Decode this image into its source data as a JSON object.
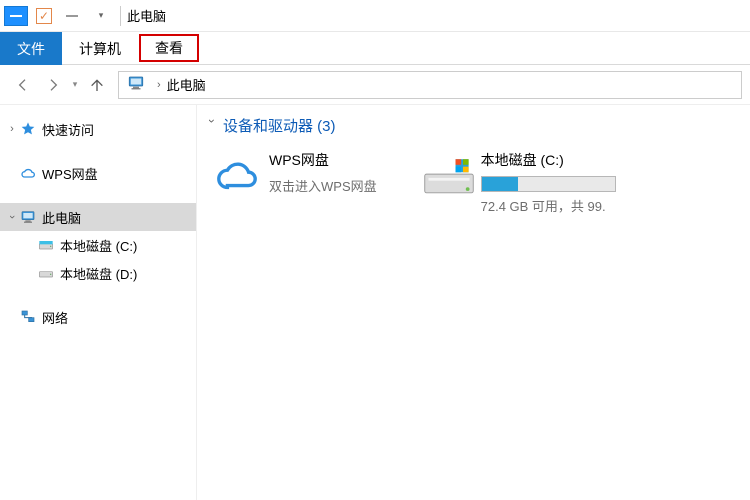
{
  "window": {
    "title": "此电脑"
  },
  "tabs": {
    "file": "文件",
    "computer": "计算机",
    "view": "查看"
  },
  "breadcrumb": {
    "location": "此电脑"
  },
  "sidebar": {
    "quick_access": "快速访问",
    "wps": "WPS网盘",
    "this_pc": "此电脑",
    "drive_c": "本地磁盘 (C:)",
    "drive_d": "本地磁盘 (D:)",
    "network": "网络"
  },
  "main": {
    "section_title": "设备和驱动器 (3)",
    "wps": {
      "title": "WPS网盘",
      "sub": "双击进入WPS网盘"
    },
    "drive_c": {
      "title": "本地磁盘 (C:)",
      "free_text": "72.4 GB 可用，共 99.",
      "fill_percent": 27
    }
  }
}
